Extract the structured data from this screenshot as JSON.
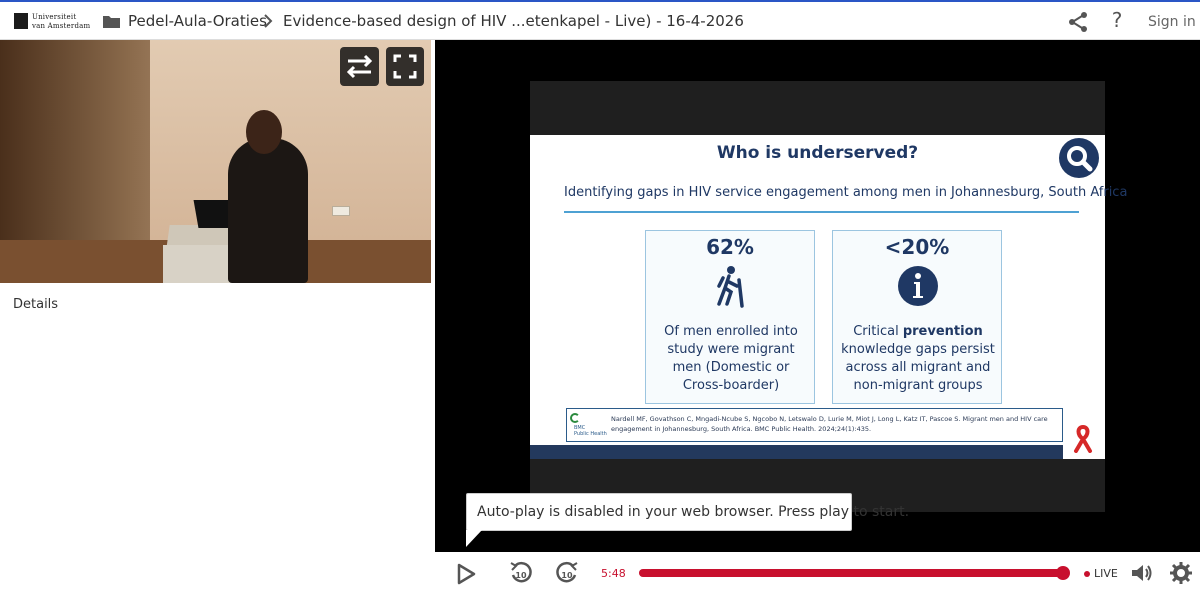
{
  "header": {
    "logo_line1": "Universiteit",
    "logo_line2": "van Amsterdam",
    "breadcrumb_folder": "Pedel-Aula-Oraties",
    "breadcrumb_title": "Evidence-based design of HIV ...etenkapel - Live) - 16-4-2026",
    "sign_in_label": "Sign in",
    "icons": [
      "folder-icon",
      "chevron-right-icon",
      "share-icon",
      "help-icon"
    ]
  },
  "left_panel": {
    "details_label": "Details",
    "overlay_buttons": [
      "swap-icon",
      "fullscreen-icon"
    ]
  },
  "slide": {
    "title": "Who is underserved?",
    "subtitle": "Identifying gaps in HIV service engagement among men in Johannesburg, South Africa",
    "card1": {
      "stat": "62%",
      "icon": "hiker-icon",
      "text": "Of men enrolled into study were migrant men (Domestic or Cross-boarder)"
    },
    "card2": {
      "stat": "<20%",
      "icon": "info-icon",
      "text_before": "Critical ",
      "text_bold": "prevention",
      "text_after": " knowledge gaps persist across all migrant and non-migrant groups"
    },
    "ref_logo_line1": "BMC",
    "ref_logo_line2": "Public Health",
    "reference": "Nardell MF, Govathson C, Mngadi-Ncube S, Ngcobo N, Letswalo D, Lurie M, Miot J, Long L, Katz IT, Pascoe S. Migrant men and HIV care engagement in Johannesburg, South Africa. BMC Public Health. 2024;24(1):435.",
    "accent_color": "#1f3864",
    "line_color": "#4ea1d3"
  },
  "autoplay_message": "Auto-play is disabled in your web browser. Press play to start.",
  "controls": {
    "time": "5:48",
    "live_label": "LIVE",
    "progress_fraction": 0.985,
    "skip_back_label": "10",
    "skip_forward_label": "10",
    "accent_color": "#c8102e",
    "icons": [
      "play-icon",
      "rewind-10-icon",
      "forward-10-icon",
      "volume-icon",
      "settings-icon"
    ]
  }
}
